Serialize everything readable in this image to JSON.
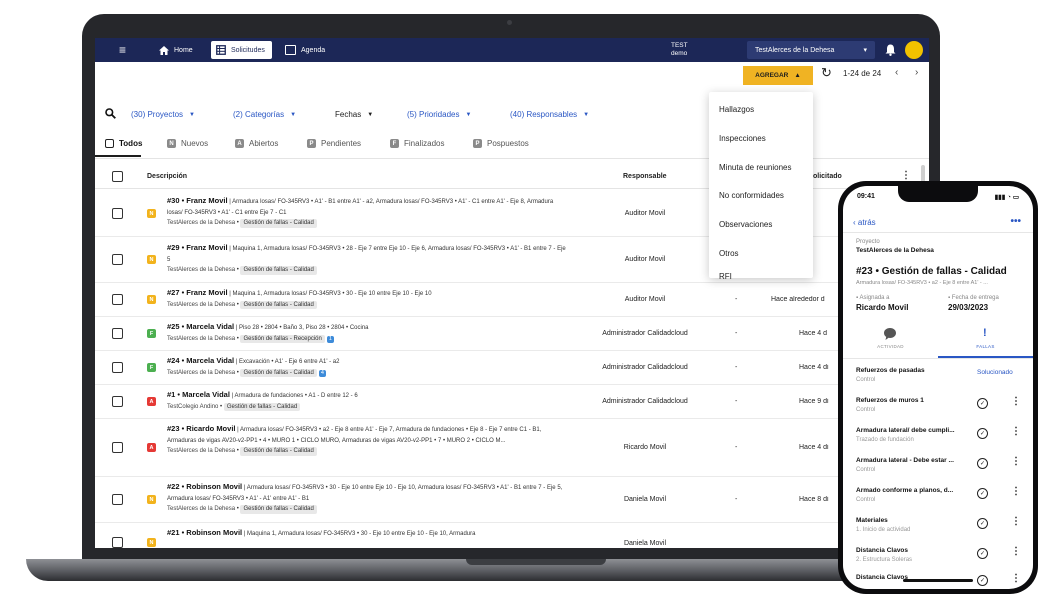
{
  "laptop": {
    "topbar": {
      "nav": [
        {
          "label": "Home"
        },
        {
          "label": "Solicitudes"
        },
        {
          "label": "Agenda"
        }
      ],
      "test_label": "TEST",
      "demo_label": "demo",
      "company": "TestAlerces de la Dehesa",
      "colors": {
        "bar": "#1c2757",
        "avatar": "#f2c200"
      }
    },
    "actions": {
      "agregar_label": "AGREGAR",
      "pager": "1-24 de 24",
      "accent": "#f0b323"
    },
    "filters": {
      "proyectos": "(30) Proyectos",
      "categorias": "(2) Categorías",
      "fechas": "Fechas",
      "prioridades": "(5) Prioridades",
      "responsables": "(40) Responsables"
    },
    "tabs": [
      {
        "label": "Todos",
        "mark": ""
      },
      {
        "label": "Nuevos",
        "mark": "N"
      },
      {
        "label": "Abiertos",
        "mark": "A"
      },
      {
        "label": "Pendientes",
        "mark": "P"
      },
      {
        "label": "Finalizados",
        "mark": "F"
      },
      {
        "label": "Pospuestos",
        "mark": "P"
      }
    ],
    "table": {
      "headers": {
        "descripcion": "Descripción",
        "responsable": "Responsable",
        "solicitado": "olicitado"
      },
      "rows": [
        {
          "severity": "N",
          "title": "#30 • Franz Movil",
          "text": " | Armadura losas/ FO-345RV3 • A1' - B1 entre A1' - a2, Armadura losas/ FO-345RV3 • A1' - C1 entre A1' - Eje 8, Armadura losas/ FO-345RV3 • A1' - C1 entre Eje 7 - C1",
          "project": "TestAlerces de la Dehesa",
          "category": "Gestión de fallas - Calidad",
          "count": "",
          "responsable": "Auditor Movil",
          "dash": "",
          "solicitado": ""
        },
        {
          "severity": "N",
          "title": "#29 • Franz Movil",
          "text": " | Maquina 1, Armadura losas/ FO-345RV3 • 28 - Eje 7 entre Eje 10 - Eje 6, Armadura losas/ FO-345RV3 • A1' - B1 entre 7 - Eje 5",
          "project": "TestAlerces de la Dehesa",
          "category": "Gestión de fallas - Calidad",
          "count": "",
          "responsable": "Auditor Movil",
          "dash": "",
          "solicitado": ""
        },
        {
          "severity": "N",
          "title": "#27 • Franz Movil",
          "text": " | Maquina 1, Armadura losas/ FO-345RV3 • 30 - Eje 10 entre Eje 10 - Eje 10",
          "project": "TestAlerces de la Dehesa",
          "category": "Gestión de fallas - Calidad",
          "count": "",
          "responsable": "Auditor Movil",
          "dash": "-",
          "solicitado": "Hace alrededor d"
        },
        {
          "severity": "F",
          "title": "#25 • Marcela Vidal",
          "text": " | Piso 28 • 2804 • Baño 3, Piso 28 • 2804 • Cocina",
          "project": "TestAlerces de la Dehesa",
          "category": "Gestión de fallas - Recepción",
          "count": "1",
          "responsable": "Administrador Calidadcloud",
          "dash": "-",
          "solicitado": "Hace 4 d"
        },
        {
          "severity": "F",
          "title": "#24 • Marcela Vidal",
          "text": " | Excavación • A1' - Eje 6 entre A1' - a2",
          "project": "TestAlerces de la Dehesa",
          "category": "Gestión de fallas - Calidad",
          "count": "4",
          "responsable": "Administrador Calidadcloud",
          "dash": "-",
          "solicitado": "Hace 4 di"
        },
        {
          "severity": "A",
          "title": "#1 • Marcela Vidal",
          "text": " | Armadura de fundaciones • A1 - D entre 12 - 6",
          "project": "TestColegio Andino",
          "category": "Gestión de fallas - Calidad",
          "count": "",
          "responsable": "Administrador Calidadcloud",
          "dash": "-",
          "solicitado": "Hace 9 di"
        },
        {
          "severity": "A",
          "title": "#23 • Ricardo Movil",
          "text": " | Armadura losas/ FO-345RV3 • a2 - Eje 8 entre A1' - Eje 7, Armadura de fundaciones • Eje 8 - Eje 7 entre C1 - B1, Armaduras de vigas AV20-v2-PP1 • 4 • MURO 1 • CICLO MURO, Armaduras de vigas AV20-v2-PP1 • 7 • MURO 2 • CICLO M...",
          "project": "TestAlerces de la Dehesa",
          "category": "Gestión de fallas - Calidad",
          "count": "",
          "responsable": "Ricardo Movil",
          "dash": "-",
          "solicitado": "Hace 4 di"
        },
        {
          "severity": "N",
          "title": "#22 • Robinson Movil",
          "text": " | Armadura losas/ FO-345RV3 • 30 - Eje 10 entre Eje 10 - Eje 10, Armadura losas/ FO-345RV3 • A1' - B1 entre 7 - Eje 5, Armadura losas/ FO-345RV3 • A1' - A1' entre A1' - B1",
          "project": "TestAlerces de la Dehesa",
          "category": "Gestión de fallas - Calidad",
          "count": "",
          "responsable": "Daniela Movil",
          "dash": "-",
          "solicitado": "Hace 8 di"
        },
        {
          "severity": "N",
          "title": "#21 • Robinson Movil",
          "text": " | Maquina 1, Armadura losas/ FO-345RV3 • 30 - Eje 10 entre Eje 10 - Eje 10, Armadura",
          "project": "",
          "category": "",
          "count": "",
          "responsable": "Daniela Movil",
          "dash": "",
          "solicitado": ""
        }
      ]
    },
    "menu": [
      "Hallazgos",
      "Inspecciones",
      "Minuta de reuniones",
      "No conformidades",
      "Observaciones",
      "Otros",
      "RFI"
    ]
  },
  "phone": {
    "time": "09:41",
    "back": "atrás",
    "proyecto_label": "Proyecto",
    "proyecto": "TestAlerces de la Dehesa",
    "title": "#23 • Gestión de fallas - Calidad",
    "subtitle": "Armadura losas/ FO-345RV3 • a2 - Eje 8 entre A1' - ...",
    "asignada_label": "Asignada a",
    "asignada": "Ricardo Movil",
    "fecha_label": "Fecha de entrega",
    "fecha": "29/03/2023",
    "tabs": [
      "ACTIVIDAD",
      "FALLAS"
    ],
    "items": [
      {
        "title": "Refuerzos de pasadas",
        "sub": "Control",
        "status": "Solucionado"
      },
      {
        "title": "Refuerzos de muros 1",
        "sub": "Control",
        "status": ""
      },
      {
        "title": "Armadura lateral/ debe cumpli...",
        "sub": "Trazado de fundación",
        "status": ""
      },
      {
        "title": "Armadura lateral - Debe estar ...",
        "sub": "Control",
        "status": ""
      },
      {
        "title": "Armado conforme a planos, d...",
        "sub": "Control",
        "status": ""
      },
      {
        "title": "Materiales",
        "sub": "1. Inicio de actividad",
        "status": ""
      },
      {
        "title": "Distancia Clavos",
        "sub": "2. Estructura Soleras",
        "status": ""
      },
      {
        "title": "Distancia Clavos",
        "sub": "",
        "status": ""
      }
    ]
  }
}
